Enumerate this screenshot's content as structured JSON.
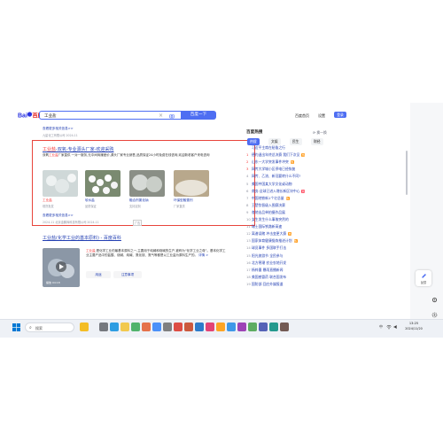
{
  "header": {
    "logo_text": "Bai 百度",
    "query": "工业盐",
    "search_button": "百度一下",
    "links": [
      "百度首页",
      "设置"
    ],
    "login": "登录"
  },
  "results": {
    "prev_more": "查看更多相关信息>>",
    "prev_meta": "2022-11",
    "prev_source": "九星化工有限公司 2024-11",
    "ad": {
      "title_red": "工业盐",
      "title_rest": "-双氧-专业源头厂家-欢迎采购",
      "desc_lead": "双氧",
      "desc_red": "工业盐",
      "desc_rest": "厂家直供 一对一服务,无中间商赚差价,源头厂家专业销售,品质保证24小时免费在线咨询,欢迎新老客户来电咨询",
      "thumbs": [
        {
          "cap": "工业盐",
          "sub": "现货批发"
        },
        {
          "cap": "软水盐",
          "sub": "品质保证"
        },
        {
          "cap": "融合剂氯化钠",
          "sub": "支持定制"
        },
        {
          "cap": "环保型融雪剂",
          "sub": "厂家直供"
        }
      ],
      "more": "查看更多相关信息>>",
      "meta": "2024-11 北京金鹏辉科技有限公司 2024-11",
      "ad_tag": "广告"
    },
    "baike": {
      "title": "工业盐(化学工业的基本原料) - 百度百科",
      "desc_red": "工业盐",
      "desc_rest": ",是化学工业的最基本原料之一,主要用于纯碱和烧碱的生产,被称为“化学工业之母”。基本化学工业主要产品中的盐酸、烧碱、纯碱、氯化铵、氯气等都是以工业盐为原料生产的。",
      "desc_more": "详情 >",
      "video_label": "播放 04:18",
      "buttons": [
        "用途",
        "注意事项"
      ]
    }
  },
  "hot": {
    "heading": "百度热搜",
    "refresh": "换一换",
    "tabs": [
      "热搜",
      "文娱",
      "民生",
      "财经"
    ],
    "items": [
      {
        "n": "",
        "t": "习近平主席在秘鲁之行",
        "badge": ""
      },
      {
        "n": "1",
        "t": "德约退出年终总决赛 我们下次见",
        "badge": "热"
      },
      {
        "n": "2",
        "t": "山东一大学突发事件冲突",
        "badge": "热"
      },
      {
        "n": "3",
        "t": "网传大学城小区停电已经恢复",
        "badge": ""
      },
      {
        "n": "4",
        "t": "网传、乙流、新冠要转什么不同?",
        "badge": ""
      },
      {
        "n": "5",
        "t": "美国中国某大学文化或动物",
        "badge": ""
      },
      {
        "n": "6",
        "t": "商务:全球已进入增长新区块中心",
        "badge": "新"
      },
      {
        "n": "7",
        "t": "中国地铁新1个亿总量",
        "badge": "热"
      },
      {
        "n": "8",
        "t": "王楚钦晋级入围赛决赛",
        "badge": ""
      },
      {
        "n": "9",
        "t": "各地出品单拍摄作品展",
        "badge": ""
      },
      {
        "n": "10",
        "t": "女生发生什么事故突然的",
        "badge": ""
      },
      {
        "n": "11",
        "t": "瑞士国际铁路新高速",
        "badge": ""
      },
      {
        "n": "12",
        "t": "离谱误赌 冲击变更大赛",
        "badge": "热"
      },
      {
        "n": "13",
        "t": "国家体育健康锻炼推进计划",
        "badge": "热"
      },
      {
        "n": "14",
        "t": "球员事件 多国联手打击",
        "badge": ""
      },
      {
        "n": "15",
        "t": "阳光旅游节 全民参与",
        "badge": ""
      },
      {
        "n": "16",
        "t": "北方寒潮 农业农地开发",
        "badge": ""
      },
      {
        "n": "17",
        "t": "杨梓墨 暴雨直播新闻",
        "badge": ""
      },
      {
        "n": "18",
        "t": "美国感冒药 联合国发布",
        "badge": ""
      },
      {
        "n": "19",
        "t": "国防部 回应外媒报道",
        "badge": ""
      }
    ]
  },
  "feedback": "反馈",
  "taskbar": {
    "search_placeholder": "搜索",
    "time": "13:25",
    "date": "2024/11/20",
    "lang": "中"
  },
  "colors": {
    "accent": "#4e6ef2",
    "red": "#f73131",
    "link": "#2440b3",
    "ad_border": "#e8453c"
  }
}
